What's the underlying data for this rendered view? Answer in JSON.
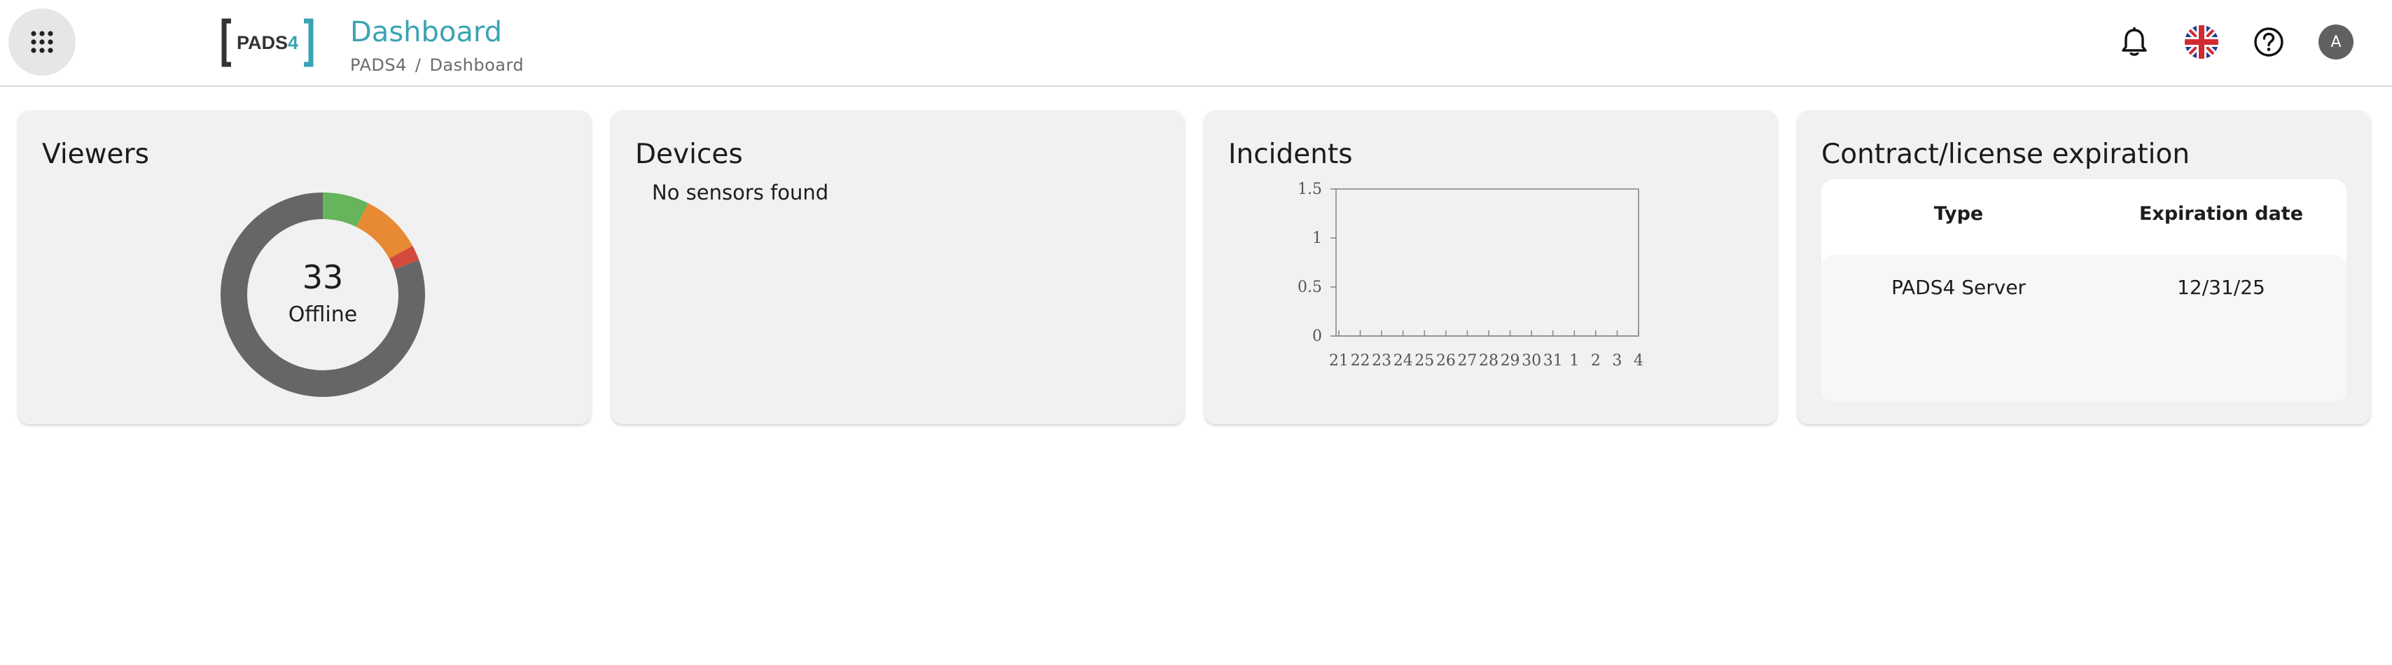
{
  "header": {
    "title": "Dashboard",
    "breadcrumb": [
      "PADS4",
      "Dashboard"
    ],
    "breadcrumb_separator": "/",
    "logo_text": "PADS4",
    "avatar_initial": "A",
    "accent_color": "#3aa3b3"
  },
  "icons": {
    "apps": "apps-grid-icon",
    "notifications": "bell-icon",
    "language": "uk-flag-icon",
    "help": "help-circle-icon",
    "account": "avatar-icon"
  },
  "cards": {
    "viewers": {
      "title": "Viewers",
      "donut_value": "33",
      "donut_label": "Offline",
      "segments": [
        {
          "status": "online",
          "value": 3,
          "color": "#66b45c"
        },
        {
          "status": "warning",
          "value": 4,
          "color": "#e88a33"
        },
        {
          "status": "error",
          "value": 1,
          "color": "#d44a3c"
        },
        {
          "status": "offline",
          "value": 33,
          "color": "#666666"
        }
      ]
    },
    "devices": {
      "title": "Devices",
      "message": "No sensors found"
    },
    "incidents": {
      "title": "Incidents"
    },
    "contract": {
      "title": "Contract/license expiration",
      "columns": [
        "Type",
        "Expiration date"
      ],
      "rows": [
        {
          "type": "PADS4 Server",
          "expiration": "12/31/25"
        }
      ]
    }
  },
  "chart_data": {
    "type": "line",
    "title": "",
    "xlabel": "",
    "ylabel": "",
    "categories": [
      "21",
      "22",
      "23",
      "24",
      "25",
      "26",
      "27",
      "28",
      "29",
      "30",
      "31",
      "1",
      "2",
      "3",
      "4"
    ],
    "y_ticks": [
      "0",
      "0.5",
      "1",
      "1.5"
    ],
    "ylim": [
      0,
      1.5
    ],
    "series": [
      {
        "values": [
          0,
          0,
          0,
          0,
          0,
          0,
          0,
          0,
          0,
          0,
          0,
          0,
          0,
          0,
          0
        ]
      }
    ],
    "grid": false
  }
}
